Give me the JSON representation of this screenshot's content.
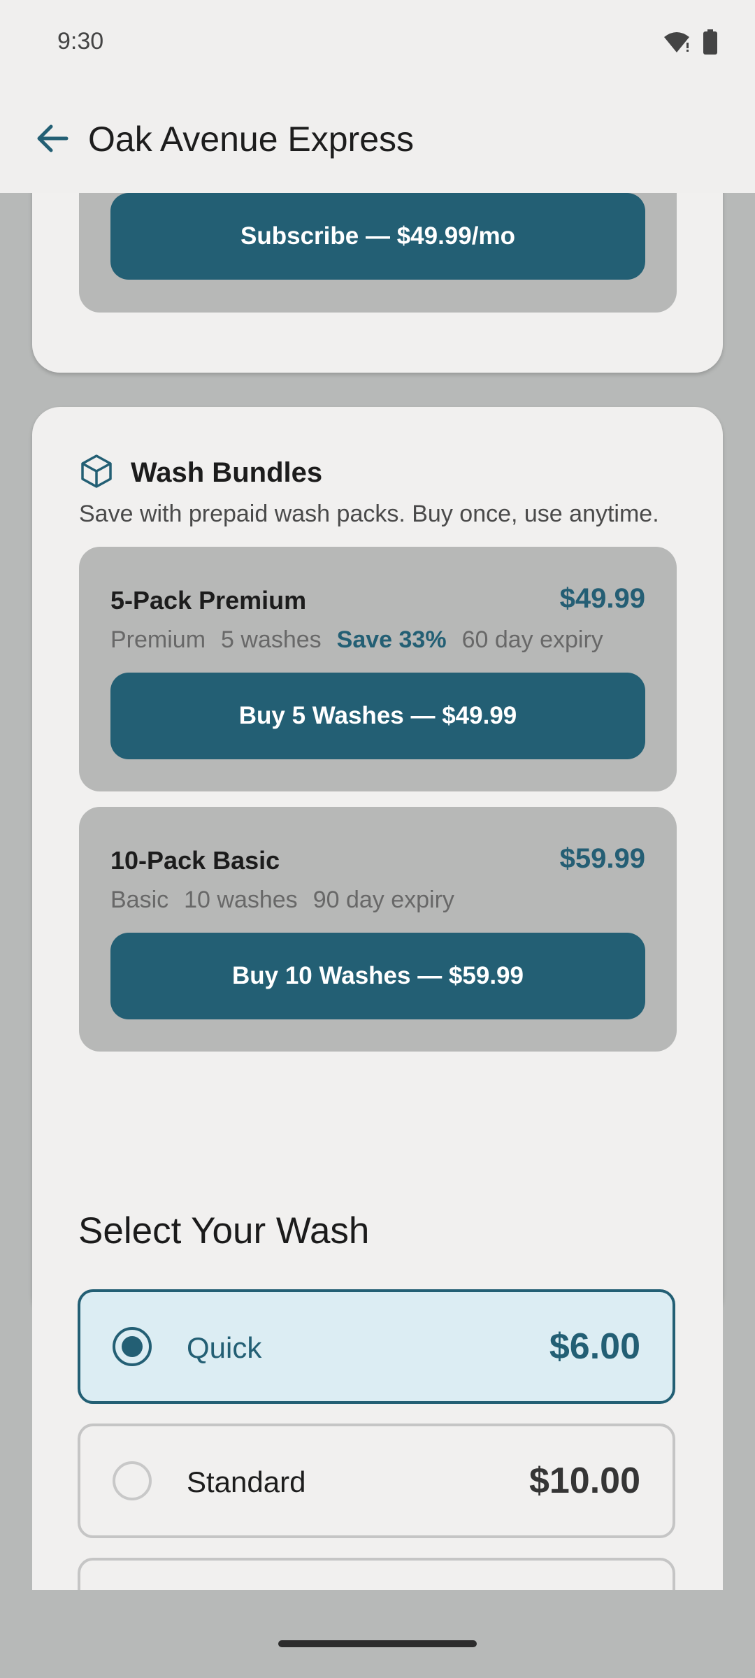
{
  "status": {
    "time": "9:30"
  },
  "header": {
    "title": "Oak Avenue Express"
  },
  "subscription": {
    "button_label": "Subscribe — $49.99/mo"
  },
  "bundles": {
    "title": "Wash Bundles",
    "description": "Save with prepaid wash packs. Buy once, use anytime.",
    "items": [
      {
        "name": "5-Pack Premium",
        "price": "$49.99",
        "tier": "Premium",
        "washes": "5 washes",
        "save": "Save 33%",
        "expiry": "60 day expiry",
        "button": "Buy 5 Washes — $49.99"
      },
      {
        "name": "10-Pack Basic",
        "price": "$59.99",
        "tier": "Basic",
        "washes": "10 washes",
        "expiry": "90 day expiry",
        "button": "Buy 10 Washes — $59.99"
      }
    ]
  },
  "select_wash": {
    "title": "Select Your Wash",
    "options": [
      {
        "label": "Quick",
        "price": "$6.00",
        "selected": true
      },
      {
        "label": "Standard",
        "price": "$10.00",
        "selected": false
      }
    ]
  },
  "colors": {
    "accent": "#235f74",
    "selected_bg": "#dcedf3",
    "card_bg": "#f1f0ef",
    "inner_bg": "#b7b8b7"
  }
}
